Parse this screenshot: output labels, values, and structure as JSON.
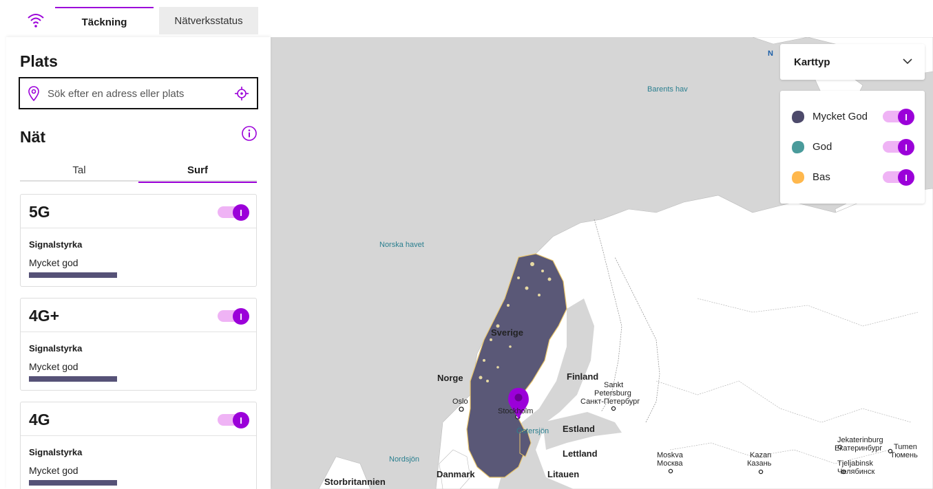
{
  "header": {
    "tabs": [
      {
        "label": "Täckning",
        "active": true
      },
      {
        "label": "Nätverksstatus",
        "active": false
      }
    ]
  },
  "sidebar": {
    "plats_title": "Plats",
    "search": {
      "placeholder": "Sök efter en adress eller plats",
      "value": ""
    },
    "nat_title": "Nät",
    "subtabs": [
      {
        "label": "Tal",
        "active": false
      },
      {
        "label": "Surf",
        "active": true
      }
    ],
    "cards": [
      {
        "title": "5G",
        "signal_label": "Signalstyrka",
        "quality": "Mycket god",
        "enabled": true,
        "toggle_glyph": "I"
      },
      {
        "title": "4G+",
        "signal_label": "Signalstyrka",
        "quality": "Mycket god",
        "enabled": true,
        "toggle_glyph": "I"
      },
      {
        "title": "4G",
        "signal_label": "Signalstyrka",
        "quality": "Mycket god",
        "enabled": true,
        "toggle_glyph": "I"
      }
    ]
  },
  "map": {
    "map_type_label": "Karttyp",
    "legend": [
      {
        "label": "Mycket God",
        "color": "#4d4a6b",
        "enabled": true
      },
      {
        "label": "God",
        "color": "#4a9b9b",
        "enabled": true
      },
      {
        "label": "Bas",
        "color": "#ffb84d",
        "enabled": true
      }
    ],
    "labels": {
      "n_marker": "N",
      "barents": "Barents hav",
      "norska_havet": "Norska havet",
      "sverige": "Sverige",
      "norge": "Norge",
      "finland": "Finland",
      "sankt": "Sankt",
      "petersburg": "Petersburg",
      "sankt_ru": "Санкт-Петербург",
      "oslo": "Oslo",
      "stockholm": "Stockholm",
      "ostersjon": "Östersjön",
      "estland": "Estland",
      "lettland": "Lettland",
      "nordsjon": "Nordsjön",
      "danmark": "Danmark",
      "storbritannien": "Storbritannien",
      "litauen": "Litauen",
      "moskva": "Moskva",
      "moskva_ru": "Москва",
      "kazan": "Kazan",
      "kazan_ru": "Казань",
      "jekaterinburg": "Jekaterinburg",
      "jekaterinburg_ru": "Екатеринбург",
      "tumen": "Tumen",
      "tumen_ru": "Тюмень",
      "tjeljabinsk": "Tjeljabinsk",
      "tjeljabinsk_ru": "Челябинск"
    },
    "colors": {
      "water": "#d6d6d6",
      "land": "#ffffff",
      "coverage": "#5a5877",
      "coverage_edge": "#e8c46a",
      "pin": "#9b00d9"
    }
  }
}
